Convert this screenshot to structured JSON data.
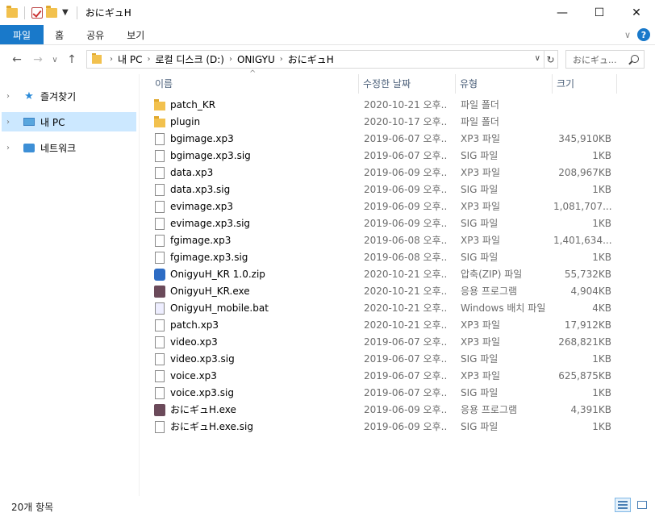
{
  "window": {
    "title": "おにギュH",
    "minimize": "—",
    "maximize": "☐",
    "close": "✕"
  },
  "ribbon": {
    "tabs": [
      "파일",
      "홈",
      "공유",
      "보기"
    ]
  },
  "address": {
    "crumbs": [
      "내 PC",
      "로컬 디스크 (D:)",
      "ONIGYU",
      "おにギュH"
    ],
    "search_placeholder": "おにギュ..."
  },
  "nav": {
    "items": [
      {
        "label": "즐겨찾기",
        "icon": "star-icon"
      },
      {
        "label": "내 PC",
        "icon": "pc-icon",
        "selected": true
      },
      {
        "label": "네트워크",
        "icon": "network-icon"
      }
    ]
  },
  "columns": {
    "name": "이름",
    "date": "수정한 날짜",
    "type": "유형",
    "size": "크기"
  },
  "files": [
    {
      "name": "patch_KR",
      "date": "2020-10-21 오후...",
      "type": "파일 폴더",
      "size": "",
      "icon": "folder"
    },
    {
      "name": "plugin",
      "date": "2020-10-17 오후...",
      "type": "파일 폴더",
      "size": "",
      "icon": "folder"
    },
    {
      "name": "bgimage.xp3",
      "date": "2019-06-07 오후...",
      "type": "XP3 파일",
      "size": "345,910KB",
      "icon": "file"
    },
    {
      "name": "bgimage.xp3.sig",
      "date": "2019-06-07 오후...",
      "type": "SIG 파일",
      "size": "1KB",
      "icon": "file"
    },
    {
      "name": "data.xp3",
      "date": "2019-06-09 오후...",
      "type": "XP3 파일",
      "size": "208,967KB",
      "icon": "file"
    },
    {
      "name": "data.xp3.sig",
      "date": "2019-06-09 오후...",
      "type": "SIG 파일",
      "size": "1KB",
      "icon": "file"
    },
    {
      "name": "evimage.xp3",
      "date": "2019-06-09 오후...",
      "type": "XP3 파일",
      "size": "1,081,707...",
      "icon": "file"
    },
    {
      "name": "evimage.xp3.sig",
      "date": "2019-06-09 오후...",
      "type": "SIG 파일",
      "size": "1KB",
      "icon": "file"
    },
    {
      "name": "fgimage.xp3",
      "date": "2019-06-08 오후...",
      "type": "XP3 파일",
      "size": "1,401,634...",
      "icon": "file"
    },
    {
      "name": "fgimage.xp3.sig",
      "date": "2019-06-08 오후...",
      "type": "SIG 파일",
      "size": "1KB",
      "icon": "file"
    },
    {
      "name": "OnigyuH_KR 1.0.zip",
      "date": "2020-10-21 오후...",
      "type": "압축(ZIP) 파일",
      "size": "55,732KB",
      "icon": "zip"
    },
    {
      "name": "OnigyuH_KR.exe",
      "date": "2020-10-21 오후...",
      "type": "응용 프로그램",
      "size": "4,904KB",
      "icon": "exe"
    },
    {
      "name": "OnigyuH_mobile.bat",
      "date": "2020-10-21 오후...",
      "type": "Windows 배치 파일",
      "size": "4KB",
      "icon": "bat"
    },
    {
      "name": "patch.xp3",
      "date": "2020-10-21 오후...",
      "type": "XP3 파일",
      "size": "17,912KB",
      "icon": "file"
    },
    {
      "name": "video.xp3",
      "date": "2019-06-07 오후...",
      "type": "XP3 파일",
      "size": "268,821KB",
      "icon": "file"
    },
    {
      "name": "video.xp3.sig",
      "date": "2019-06-07 오후...",
      "type": "SIG 파일",
      "size": "1KB",
      "icon": "file"
    },
    {
      "name": "voice.xp3",
      "date": "2019-06-07 오후...",
      "type": "XP3 파일",
      "size": "625,875KB",
      "icon": "file"
    },
    {
      "name": "voice.xp3.sig",
      "date": "2019-06-07 오후...",
      "type": "SIG 파일",
      "size": "1KB",
      "icon": "file"
    },
    {
      "name": "おにギュH.exe",
      "date": "2019-06-09 오후...",
      "type": "응용 프로그램",
      "size": "4,391KB",
      "icon": "exe"
    },
    {
      "name": "おにギュH.exe.sig",
      "date": "2019-06-09 오후...",
      "type": "SIG 파일",
      "size": "1KB",
      "icon": "file"
    }
  ],
  "status": {
    "item_count": "20개 항목"
  }
}
